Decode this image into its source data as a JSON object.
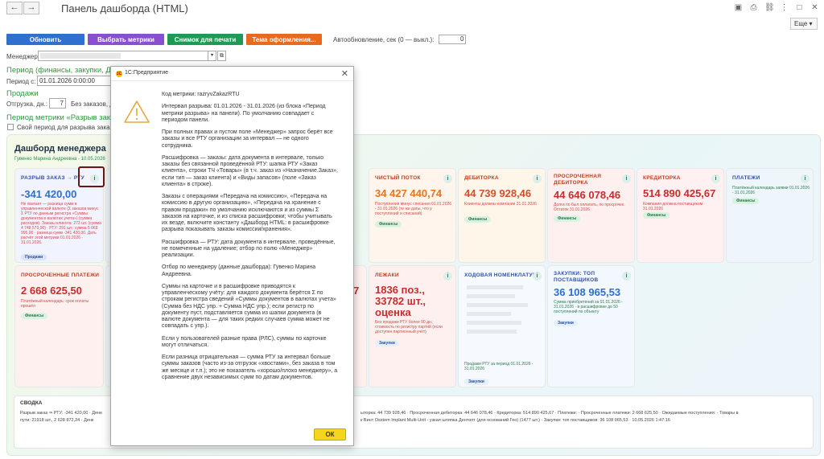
{
  "window": {
    "title": "Панель дашборда (HTML)",
    "more_label": "Еще ▾"
  },
  "toolbar": {
    "buttons": [
      {
        "label": "Обновить",
        "color": "#2f6fce"
      },
      {
        "label": "Выбрать метрики",
        "color": "#8a4fd0"
      },
      {
        "label": "Снимок для печати",
        "color": "#1e9a55"
      },
      {
        "label": "Тема оформления...",
        "color": "#e86a1e"
      }
    ],
    "autoupdate_label": "Автообновление, сек (0 — выкл.):",
    "autoupdate_value": "0"
  },
  "filters": {
    "manager_label": "Менеджер:",
    "period_section": "Период (финансы, закупки, ДС",
    "period_from_label": "Период с:",
    "period_from_value": "01.01.2026  0:00:00",
    "sales_section": "Продажи",
    "shipment_label": "Отгрузка, дн.:",
    "shipment_value": "7",
    "no_orders_label": "Без заказов, д",
    "metric_period_section": "Период метрики «Разрыв заказ",
    "own_period_label": "Свой период для разрыва заказ"
  },
  "dashboard": {
    "title": "Дашборд менеджера",
    "subtitle": "Гувенко Марина Андреевна - 10.05.2026",
    "cards": [
      {
        "header": "РАЗРЫВ ЗАКАЗ → РТУ",
        "value": "-341 420,00",
        "value_color": "#2f6fce",
        "desc": "Не хватает — разница сумм в управленческой валюте (Σ заказов минус Σ РТУ по данным регистра «Суммы документов в валютах учета») (сумма расходов). Заказы клиента: 273 шт. (сумма 4 748 573,00) · РТУ: 291 шт.; сумма 5 069 995,00 · разница сумм -341 420,00. Дать расчёт этой метрики 01.01.2026 - 31.01.2026.",
        "tag": "Продажи",
        "bg": "#f1f3ff",
        "hcolor": "#3050a8"
      },
      {
        "header": "ЧИСТЫЙ ПОТОК",
        "value": "34 427 440,74",
        "value_color": "#e8751c",
        "desc": "Поступления минус списания 01.01.2026 - 31.01.2026 (те же даты, что у поступлений и списаний)",
        "tag": "Финансы",
        "bg": "#fff5ec",
        "hcolor": "#c1401d"
      },
      {
        "header": "ДЕБИТОРКА",
        "value": "44 739 928,46",
        "value_color": "#d2502a",
        "desc": "Клиенты должны компании 31.01.2026",
        "tag": "Финансы",
        "bg": "#fff6ea",
        "hcolor": "#c1401d"
      },
      {
        "header": "ПРОСРОЧЕННАЯ ДЕБИТОРКА",
        "value": "44 646 078,46",
        "value_color": "#c82d2d",
        "desc": "Долги по был оплатить, по просрочке. Остаток 31.01.2026",
        "tag": "Финансы",
        "bg": "#fff0f0",
        "hcolor": "#c1401d"
      },
      {
        "header": "КРЕДИТОРКА",
        "value": "514 890 425,67",
        "value_color": "#c82d2d",
        "desc": "Компания должна поставщикам 31.01.2026",
        "tag": "Финансы",
        "bg": "#fff0f2",
        "hcolor": "#c1401d"
      },
      {
        "header": "ПЛАТЕЖИ",
        "value": "",
        "value_color": "#2f6fce",
        "desc": "Платёжный календарь заявки 01.01.2026 - 31.01.2026",
        "tag": "Финансы",
        "bg": "#eef6fb",
        "hcolor": "#3050a8"
      },
      {
        "header": "ПРОСРОЧЕННЫЕ ПЛАТЕЖИ",
        "value": "2 668 625,50",
        "value_color": "#c82d2d",
        "desc": "Платёжный календарь: срок оплаты прошёл",
        "tag": "Финансы",
        "bg": "#fff0f0",
        "hcolor": "#c1401d"
      },
      {
        "header": "ЛЕЖАКИ",
        "value": "1836 поз., 33782 шт., оценка",
        "value_color": "#c82d2d",
        "desc": "Без продажи РТУ более 90 дн.; стоимость по регистру партий (если доступен партионный учёт)",
        "tag": "Закупки",
        "bg": "#fff0f0",
        "hcolor": "#c1401d"
      },
      {
        "header": "ХОДОВАЯ НОМЕНКЛАТУРА",
        "value": "",
        "value_color": "#2f6fce",
        "desc": "Продажи РТУ за период 01.01.2026 - 31.01.2026",
        "tag": "Закупки",
        "bg": "#f6faff",
        "hcolor": "#3050a8"
      },
      {
        "header": "ЗАКУПКИ: ТОП ПОСТАВЩИКОВ",
        "value": "36 108 965,53",
        "value_color": "#2f6fce",
        "desc": "Сумма приобретений за 01.01.2026 - 31.01.2026 · в расшифровке до 50 поступлений по объекту",
        "tag": "Закупки",
        "bg": "#f3f8ff",
        "hcolor": "#3050a8"
      }
    ],
    "partial_digit": "7",
    "summary": {
      "title": "СВОДКА",
      "line1_left": "Разрыв заказ ⇒ РТУ: -341 420,00 · Дене",
      "line1_right": "ыторка: 44 739 928,46 · Просроченная дебиторка: 44 646 078,46 · Кредиторка: 514 890 425,67 · Платежи: · Просроченные платежи: 2 668 625,50 · Ожидаемые поступления: · Товары в",
      "line2_left": "пути: 21918 шт., 2 628 872,24 · Денк",
      "line2_right": "к Винт Osstem Implant Multi-Unit - узкая шляпка Дентопт (для оснований Гео) (1477 шт.) · Закупки: топ поставщиков: 36 108 965,53 · 10.05.2026 1:47:16"
    }
  },
  "dialog": {
    "logo_text": "1С",
    "title": "1С:Предприятие",
    "paragraphs": [
      "Код метрики: razryvZakazRTU",
      "Интервал разрыва: 01.01.2026 - 31.01.2026 (из блока «Период метрики разрыва» на панели). По умолчанию совпадает с периодом панели.",
      "При полных правах и пустом поле «Менеджер» запрос берёт все заказы и все РТУ организации за интервал — не одного сотрудника.",
      "Расшифровка — заказы: дата документа в интервале, только заказы без связанной проведённой РТУ: шапка РТУ «Заказ клиента», строки ТЧ «Товары» (в т.ч. заказ из «Назначение.Заказ», если тип — заказ клиента) и «Виды запасов» (поле «Заказ клиента» в строке).",
      "Заказы с операциями «Передача на комиссию», «Передача на комиссию в другую организацию», «Передача на хранение с правом продажи» по умолчанию исключаются и из суммы Σ заказов на карточке, и из списка расшифровки; чтобы учитывать их везде, включите константу «Дашборд HTML: в расшифровке разрыва показывать заказы комиссии/хранения».",
      "Расшифровка — РТУ: дата документа в интервале, проведённые, не помеченные на удаление; отбор по полю «Менеджер» реализации.",
      "Отбор по менеджеру (данные дашборда): Гувенко Марина Андреевна.",
      "Суммы на карточке и в расшифровке приводятся к управленческому учёту: для каждого документа берётся Σ по строкам регистра сведений «Суммы документов в валютах учета» (Сумма без НДС упр. + Сумма НДС упр.); если регистр по документу пуст, подставляется сумма из шапки документа (в валюте документа — для таких редких случаев сумма может не совпадать с упр.).",
      "Если у пользователей разные права (РЛС), суммы по карточке могут отличаться.",
      "Если разница отрицательная — сумма РТУ за интервал больше суммы заказов (часто из-за отгрузок «хвостами», без заказа в том же месяце и т.п.); это не показатель «хорошо/плохо менеджеру», а сравнение двух независимых сумм по датам документов."
    ],
    "ok_label": "ОК"
  }
}
